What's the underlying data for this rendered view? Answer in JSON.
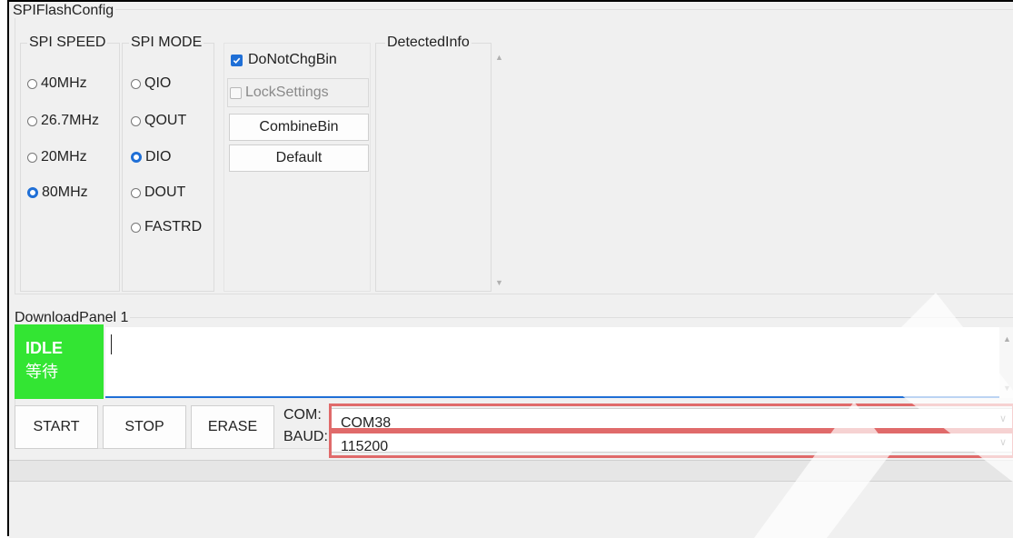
{
  "spi_flash_config": {
    "title": "SPIFlashConfig",
    "speed": {
      "title": "SPI SPEED",
      "options": [
        "40MHz",
        "26.7MHz",
        "20MHz",
        "80MHz"
      ],
      "selected": "80MHz"
    },
    "mode": {
      "title": "SPI MODE",
      "options": [
        "QIO",
        "QOUT",
        "DIO",
        "DOUT",
        "FASTRD"
      ],
      "selected": "DIO"
    },
    "checkboxes": {
      "do_not_chg_bin": {
        "label": "DoNotChgBin",
        "checked": true
      },
      "lock_settings": {
        "label": "LockSettings",
        "checked": false
      }
    },
    "buttons": {
      "combine_bin": "CombineBin",
      "default": "Default"
    },
    "detected_info": {
      "title": "DetectedInfo"
    }
  },
  "download_panel": {
    "title": "DownloadPanel 1",
    "status": {
      "line1": "IDLE",
      "line2": "等待",
      "color": "#33e533"
    },
    "buttons": {
      "start": "START",
      "stop": "STOP",
      "erase": "ERASE"
    },
    "com": {
      "label": "COM:",
      "value": "COM38"
    },
    "baud": {
      "label": "BAUD:",
      "value": "115200"
    }
  },
  "colors": {
    "accent": "#1f6fd6",
    "highlight": "#e06a6a"
  }
}
